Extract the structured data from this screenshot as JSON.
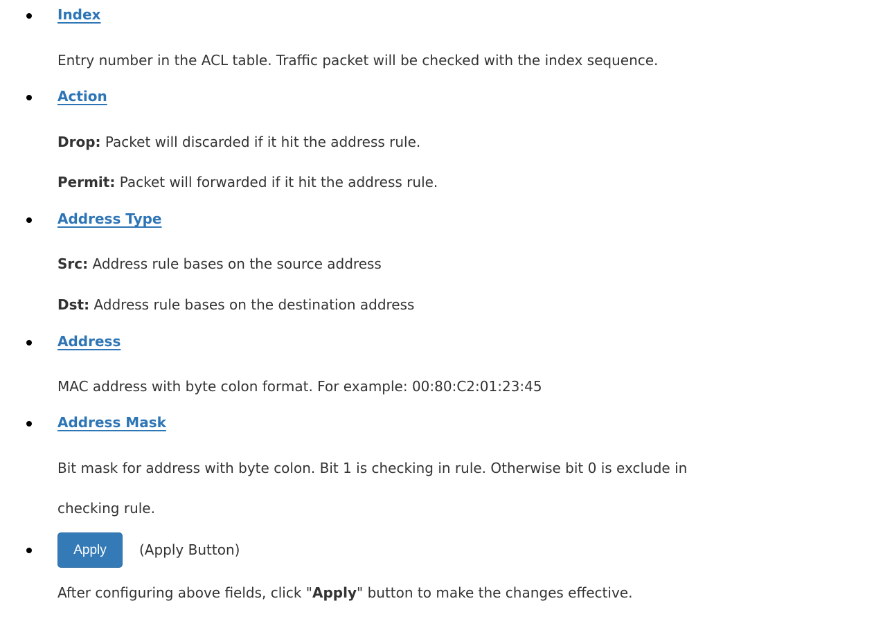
{
  "sections": [
    {
      "title": "Index",
      "lines": [
        "Entry number in the ACL table. Traffic packet will be checked with the index sequence."
      ]
    },
    {
      "title": "Action",
      "lines": [
        {
          "bold": "Drop:",
          "text": " Packet will discarded if it hit the address rule."
        },
        {
          "bold": "Permit:",
          "text": " Packet will forwarded if it hit the address rule."
        }
      ]
    },
    {
      "title": "Address Type",
      "lines": [
        {
          "bold": "Src:",
          "text": " Address rule bases on the source address"
        },
        {
          "bold": "Dst:",
          "text": " Address rule bases on the destination address"
        }
      ]
    },
    {
      "title": "Address",
      "lines": [
        "MAC address with byte colon format. For example: 00:80:C2:01:23:45"
      ]
    },
    {
      "title": "Address Mask",
      "lines": [
        "Bit mask for address with byte colon. Bit 1 is checking in rule. Otherwise bit 0 is exclude in",
        "checking rule."
      ]
    }
  ],
  "apply": {
    "button_label": "Apply",
    "button_note": "(Apply Button)",
    "description_prefix": "After configuring above fields, click \"",
    "description_bold": "Apply",
    "description_suffix": "\" button to make the changes effective."
  }
}
